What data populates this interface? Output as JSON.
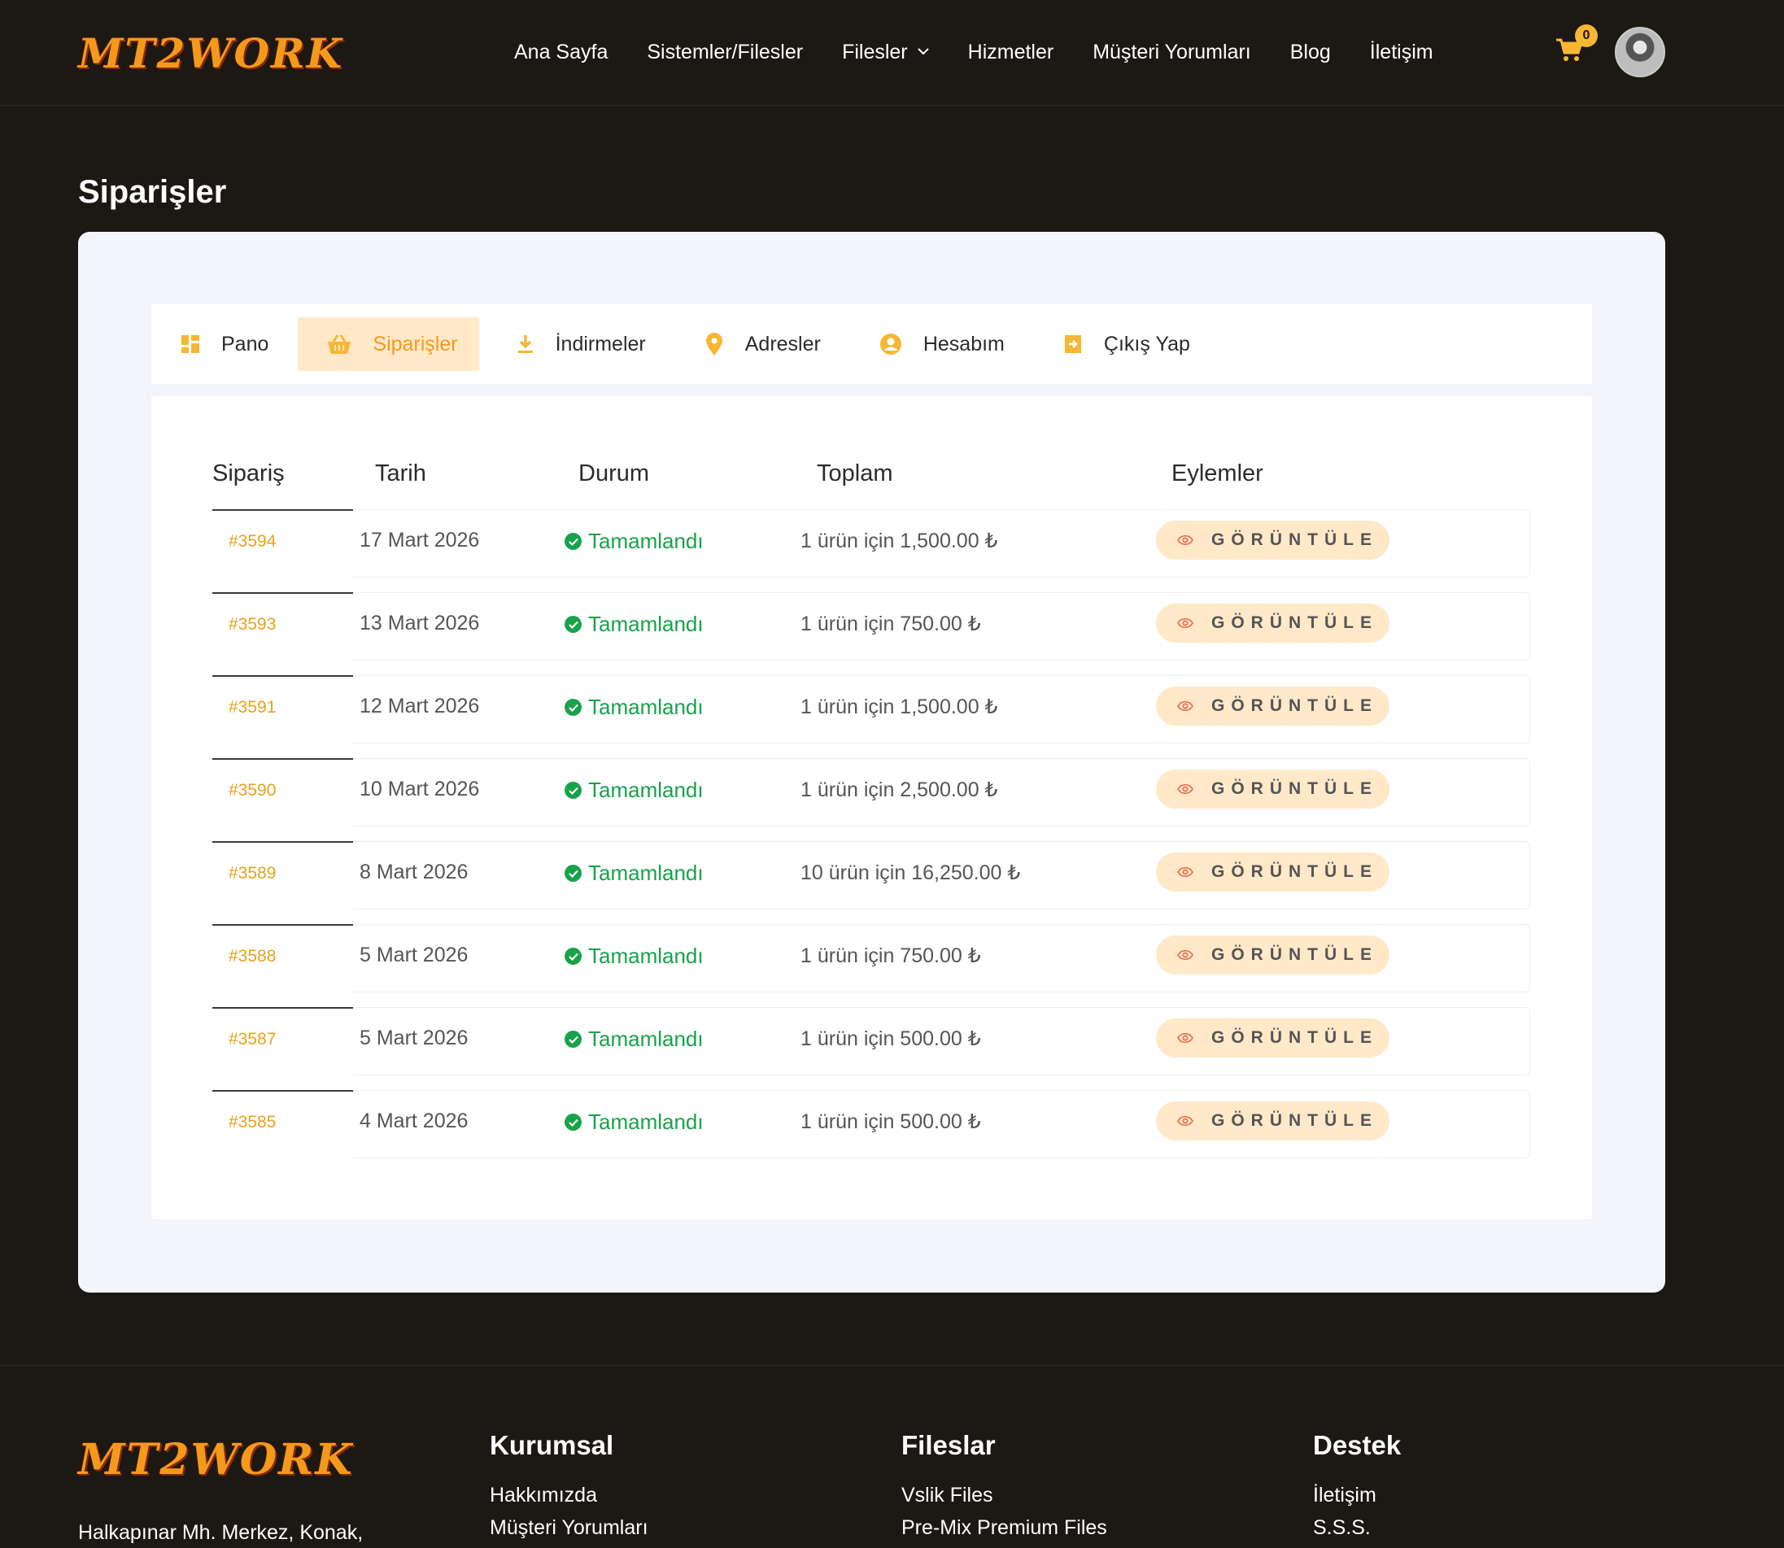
{
  "brand": {
    "logo_text": "MT2WORK"
  },
  "nav": {
    "items": [
      "Ana Sayfa",
      "Sistemler/Filesler",
      "Filesler",
      "Hizmetler",
      "Müşteri Yorumları",
      "Blog",
      "İletişim"
    ],
    "cart_count": "0"
  },
  "page": {
    "title": "Siparişler"
  },
  "tabs": [
    {
      "label": "Pano",
      "icon": "dashboard-icon"
    },
    {
      "label": "Siparişler",
      "icon": "basket-icon"
    },
    {
      "label": "İndirmeler",
      "icon": "download-icon"
    },
    {
      "label": "Adresler",
      "icon": "location-pin-icon"
    },
    {
      "label": "Hesabım",
      "icon": "user-icon"
    },
    {
      "label": "Çıkış Yap",
      "icon": "logout-icon"
    }
  ],
  "active_tab": "Siparişler",
  "table": {
    "headers": [
      "Sipariş",
      "Tarih",
      "Durum",
      "Toplam",
      "Eylemler"
    ],
    "rows": [
      {
        "id": "#3594",
        "date": "17 Mart 2026",
        "status": "Tamamlandı",
        "total": "1 ürün için 1,500.00 ₺",
        "action": "GÖRÜNTÜLE"
      },
      {
        "id": "#3593",
        "date": "13 Mart 2026",
        "status": "Tamamlandı",
        "total": "1 ürün için 750.00 ₺",
        "action": "GÖRÜNTÜLE"
      },
      {
        "id": "#3591",
        "date": "12 Mart 2026",
        "status": "Tamamlandı",
        "total": "1 ürün için 1,500.00 ₺",
        "action": "GÖRÜNTÜLE"
      },
      {
        "id": "#3590",
        "date": "10 Mart 2026",
        "status": "Tamamlandı",
        "total": "1 ürün için 2,500.00 ₺",
        "action": "GÖRÜNTÜLE"
      },
      {
        "id": "#3589",
        "date": "8 Mart 2026",
        "status": "Tamamlandı",
        "total": "10 ürün için 16,250.00 ₺",
        "action": "GÖRÜNTÜLE"
      },
      {
        "id": "#3588",
        "date": "5 Mart 2026",
        "status": "Tamamlandı",
        "total": "1 ürün için 750.00 ₺",
        "action": "GÖRÜNTÜLE"
      },
      {
        "id": "#3587",
        "date": "5 Mart 2026",
        "status": "Tamamlandı",
        "total": "1 ürün için 500.00 ₺",
        "action": "GÖRÜNTÜLE"
      },
      {
        "id": "#3585",
        "date": "4 Mart 2026",
        "status": "Tamamlandı",
        "total": "1 ürün için 500.00 ₺",
        "action": "GÖRÜNTÜLE"
      }
    ]
  },
  "footer": {
    "logo_text": "MT2WORK",
    "address": "Halkapınar Mh. Merkez, Konak,",
    "columns": [
      {
        "title": "Kurumsal",
        "links": [
          "Hakkımızda",
          "Müşteri Yorumları"
        ]
      },
      {
        "title": "Fileslar",
        "links": [
          "Vslik Files",
          "Pre-Mix Premium Files"
        ]
      },
      {
        "title": "Destek",
        "links": [
          "İletişim",
          "S.S.S."
        ]
      }
    ]
  },
  "colors": {
    "background": "#1c1813",
    "accent": "#f39a1d",
    "active_tab_bg": "#ffe9c9",
    "status_green": "#17a34a",
    "order_link": "#e8a21a"
  }
}
